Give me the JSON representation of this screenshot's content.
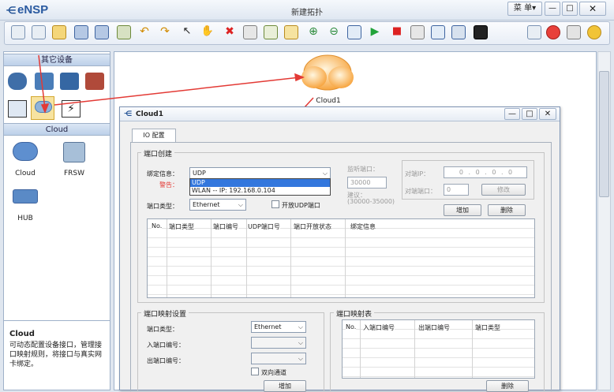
{
  "app": {
    "logo": "eNSP",
    "title": "新建拓扑",
    "menu_label": "菜 单▾"
  },
  "palette": {
    "section_other": "其它设备",
    "section_cloud": "Cloud",
    "devices": [
      {
        "label": "Cloud"
      },
      {
        "label": "FRSW"
      },
      {
        "label": "HUB"
      }
    ],
    "info_title": "Cloud",
    "info_text": "可动态配置设备接口，管理接口映射规则，将接口与真实网卡绑定。"
  },
  "canvas": {
    "node_label": "Cloud1"
  },
  "dialog": {
    "title": "Cloud1",
    "tab": "IO 配置",
    "port_create": {
      "group_label": "端口创建",
      "bind_label": "绑定信息：",
      "bind_value": "UDP",
      "dropdown_options": [
        "UDP",
        "WLAN -- IP: 192.168.0.104"
      ],
      "warning_label": "警告：",
      "port_type_label": "端口类型：",
      "port_type_value": "Ethernet",
      "open_udp_label": "开放UDP端口",
      "listen_port_label": "监听端口：",
      "listen_port_value": "30000",
      "suggest_label": "建议：",
      "suggest_range": "(30000-35000)",
      "peer_ip_label": "对端IP：",
      "peer_ip_value": "0 . 0 . 0 . 0",
      "peer_port_label": "对端端口：",
      "peer_port_value": "0",
      "modify_btn": "修改",
      "add_btn": "增加",
      "delete_btn": "删除",
      "table_headers": [
        "No.",
        "端口类型",
        "端口编号",
        "UDP端口号",
        "端口开放状态",
        "绑定信息"
      ]
    },
    "port_map": {
      "group_label": "端口映射设置",
      "port_type_label": "端口类型：",
      "port_type_value": "Ethernet",
      "in_port_label": "入端口编号：",
      "out_port_label": "出端口编号：",
      "bidirectional_label": "双向通道",
      "add_btn": "增加"
    },
    "map_table": {
      "group_label": "端口映射表",
      "headers": [
        "No.",
        "入端口编号",
        "出端口编号",
        "端口类型"
      ],
      "delete_btn": "删除"
    }
  },
  "colors": {
    "accent_red": "#e33a35",
    "cloud_orange": "#f7a540"
  }
}
